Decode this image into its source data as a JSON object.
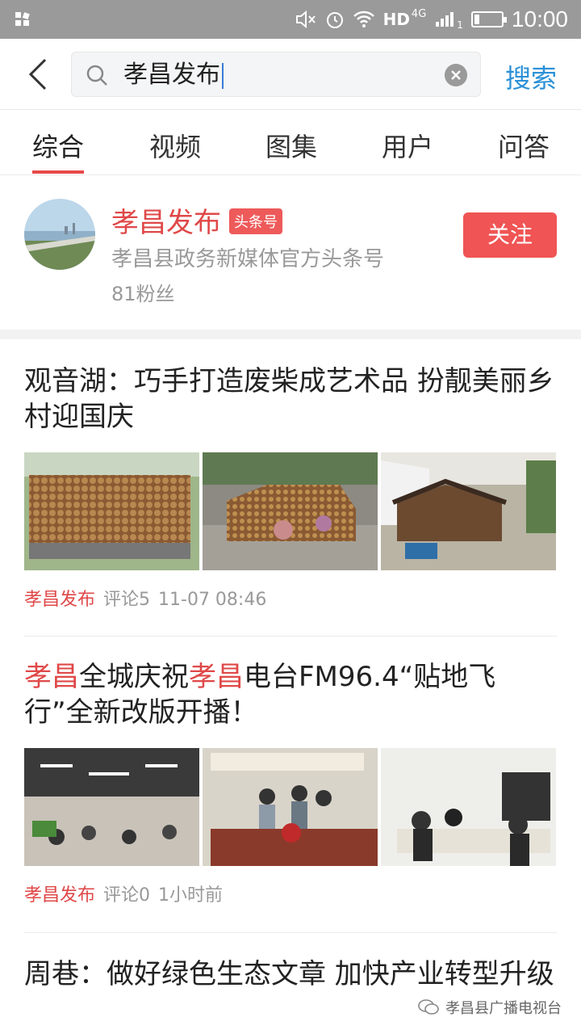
{
  "status_bar": {
    "network": "HD",
    "network_gen": "4G",
    "sim_slot": "1",
    "time": "10:00"
  },
  "search": {
    "value": "孝昌发布",
    "button_label": "搜索"
  },
  "tabs": [
    {
      "label": "综合",
      "active": true
    },
    {
      "label": "视频",
      "active": false
    },
    {
      "label": "图集",
      "active": false
    },
    {
      "label": "用户",
      "active": false
    },
    {
      "label": "问答",
      "active": false
    }
  ],
  "user": {
    "name": "孝昌发布",
    "badge": "头条号",
    "description": "孝昌县政务新媒体官方头条号",
    "fans": "81粉丝",
    "follow_label": "关注"
  },
  "articles": [
    {
      "title": "观音湖：巧手打造废柴成艺术品 扮靓美丽乡村迎国庆",
      "source": "孝昌发布",
      "comments": "评论5",
      "time": "11-07 08:46"
    },
    {
      "title_parts": [
        "孝昌",
        "全城庆祝",
        "孝昌",
        "电台FM96.4“贴地飞行”全新改版开播！"
      ],
      "source": "孝昌发布",
      "comments": "评论0",
      "time": "1小时前"
    },
    {
      "title": "周巷：做好绿色生态文章 加快产业转型升级"
    }
  ],
  "watermark": "孝昌县广播电视台",
  "colors": {
    "accent_red": "#e04848",
    "search_blue": "#2a90d7",
    "status_bar": "#9a9a9a"
  }
}
